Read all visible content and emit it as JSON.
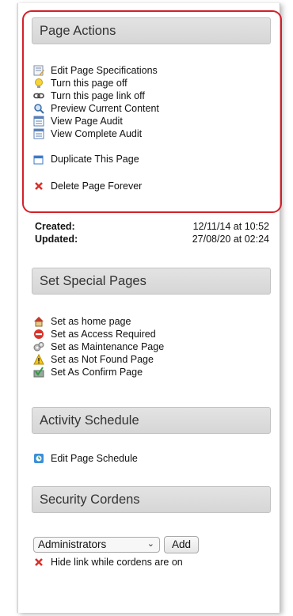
{
  "page_actions": {
    "title": "Page Actions",
    "items": [
      {
        "label": "Edit Page Specifications",
        "icon": "edit-document-icon"
      },
      {
        "label": "Turn this page off",
        "icon": "lightbulb-icon"
      },
      {
        "label": "Turn this page link off",
        "icon": "link-icon"
      },
      {
        "label": "Preview Current Content",
        "icon": "magnifier-icon"
      },
      {
        "label": "View Page Audit",
        "icon": "audit-list-icon"
      },
      {
        "label": "View Complete Audit",
        "icon": "audit-list-icon"
      },
      {
        "label": "Duplicate This Page",
        "icon": "duplicate-window-icon"
      },
      {
        "label": "Delete Page Forever",
        "icon": "red-x-icon"
      }
    ]
  },
  "meta": {
    "created_label": "Created:",
    "created_value": "12/11/14 at 10:52",
    "updated_label": "Updated:",
    "updated_value": "27/08/20 at 02:24"
  },
  "special_pages": {
    "title": "Set Special Pages",
    "items": [
      {
        "label": "Set as home page",
        "icon": "home-icon"
      },
      {
        "label": "Set as Access Required",
        "icon": "no-entry-icon"
      },
      {
        "label": "Set as Maintenance Page",
        "icon": "gears-icon"
      },
      {
        "label": "Set as Not Found Page",
        "icon": "warning-icon"
      },
      {
        "label": "Set As Confirm Page",
        "icon": "confirm-icon"
      }
    ]
  },
  "activity": {
    "title": "Activity Schedule",
    "items": [
      {
        "label": "Edit Page Schedule",
        "icon": "schedule-icon"
      }
    ]
  },
  "security": {
    "title": "Security Cordens",
    "select_value": "Administrators",
    "add_label": "Add",
    "items": [
      {
        "label": "Hide link while cordens are on",
        "icon": "red-x-icon"
      }
    ]
  },
  "colors": {
    "highlight": "#d4202a",
    "header_bg": "#dcdcdc"
  }
}
